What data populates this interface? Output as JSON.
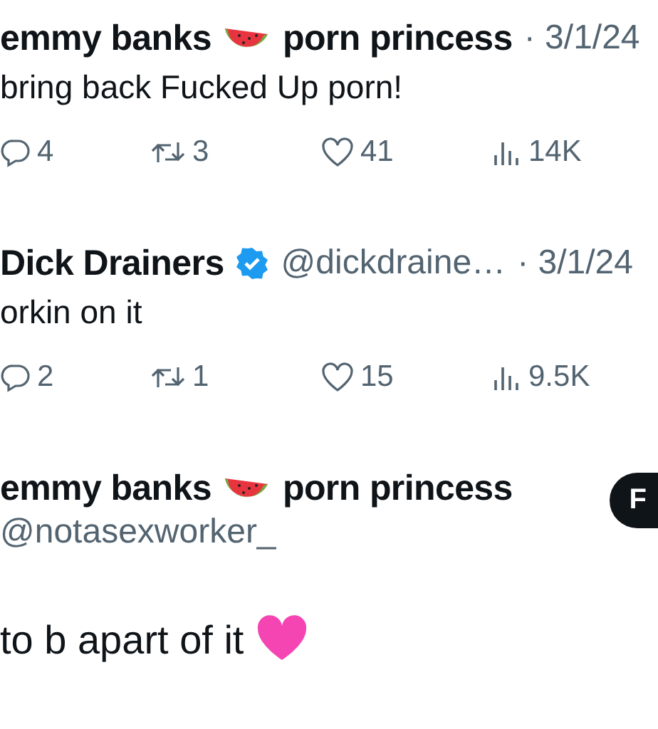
{
  "thread": [
    {
      "name_parts": [
        "emmy banks",
        "porn princess"
      ],
      "verified": false,
      "date": "· 3/1/24",
      "text": "bring back Fucked Up porn!",
      "stats": {
        "replies": "4",
        "reposts": "3",
        "likes": "41",
        "views": "14K"
      }
    },
    {
      "name_parts": [
        "Dick Drainers"
      ],
      "verified": true,
      "handle": "@dickdraine…",
      "date": "· 3/1/24",
      "text": "orkin on it",
      "stats": {
        "replies": "2",
        "reposts": "1",
        "likes": "15",
        "views": "9.5K"
      }
    }
  ],
  "main_post": {
    "name_parts": [
      "emmy banks",
      "porn princess"
    ],
    "handle": "@notasexworker_",
    "follow_button": "F",
    "text": "to b apart of it"
  }
}
